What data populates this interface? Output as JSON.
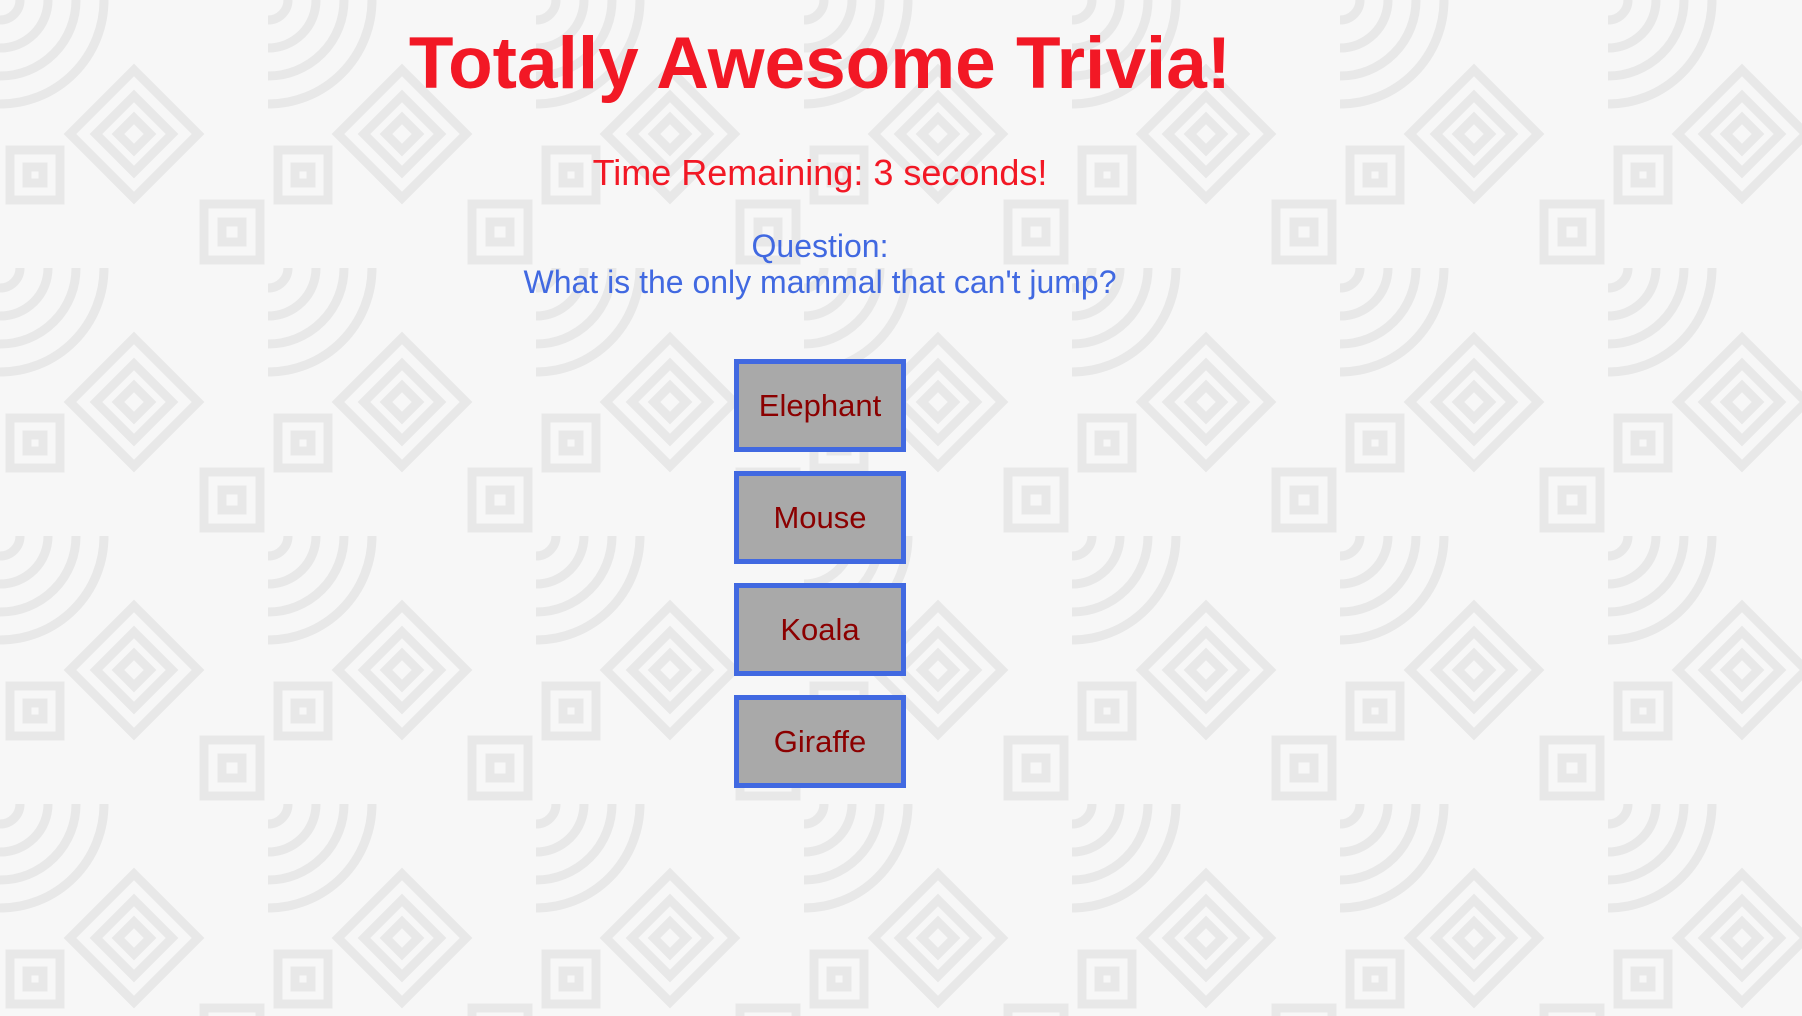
{
  "app": {
    "title": "Totally Awesome Trivia!"
  },
  "timer": {
    "text": "Time Remaining: 3 seconds!"
  },
  "question": {
    "label": "Question:",
    "text": "What is the only mammal that can't jump?"
  },
  "answers": [
    {
      "label": "Elephant"
    },
    {
      "label": "Mouse"
    },
    {
      "label": "Koala"
    },
    {
      "label": "Giraffe"
    }
  ],
  "colors": {
    "title": "#f21825",
    "timer": "#f21825",
    "question": "#4169e1",
    "answer_text": "#8b0000",
    "answer_bg": "#a9a9a9",
    "answer_border": "#4169e1",
    "background_pattern": "#e8e8e8"
  }
}
